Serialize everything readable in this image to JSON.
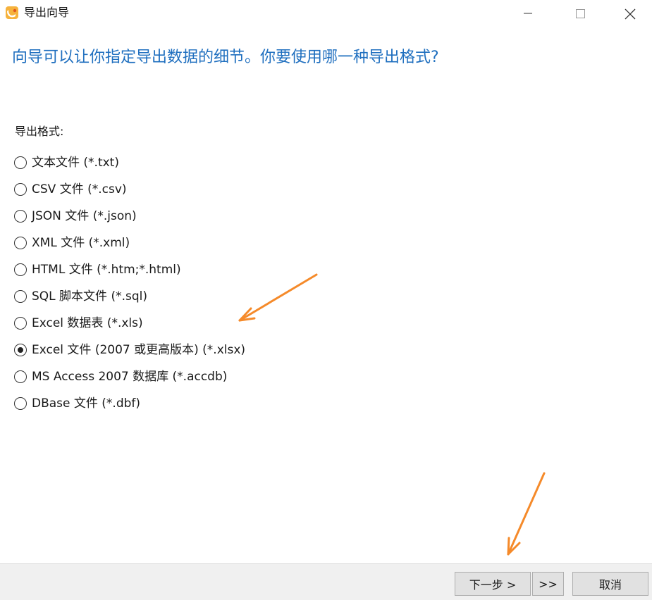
{
  "window": {
    "title": "导出向导"
  },
  "headline": "向导可以让你指定导出数据的细节。你要使用哪一种导出格式?",
  "format_group": {
    "label": "导出格式:",
    "selected_index": 7,
    "options": [
      "文本文件 (*.txt)",
      "CSV 文件 (*.csv)",
      "JSON 文件 (*.json)",
      "XML 文件 (*.xml)",
      "HTML 文件 (*.htm;*.html)",
      "SQL 脚本文件 (*.sql)",
      "Excel 数据表 (*.xls)",
      "Excel 文件 (2007 或更高版本) (*.xlsx)",
      "MS Access 2007 数据库 (*.accdb)",
      "DBase 文件 (*.dbf)"
    ]
  },
  "footer": {
    "next_label": "下一步 >",
    "last_label": ">>",
    "cancel_label": "取消"
  },
  "icons": {
    "app": "navicat-app-icon",
    "minimize": "minimize-icon",
    "maximize": "maximize-icon",
    "close": "close-icon",
    "radio": "radio-icon",
    "annotation": "arrow-icon"
  },
  "colors": {
    "headline": "#1f6fbf",
    "annotation_arrow": "#f58a2a",
    "footer_bg": "#f0f0f0",
    "button_bg": "#e1e1e1"
  }
}
